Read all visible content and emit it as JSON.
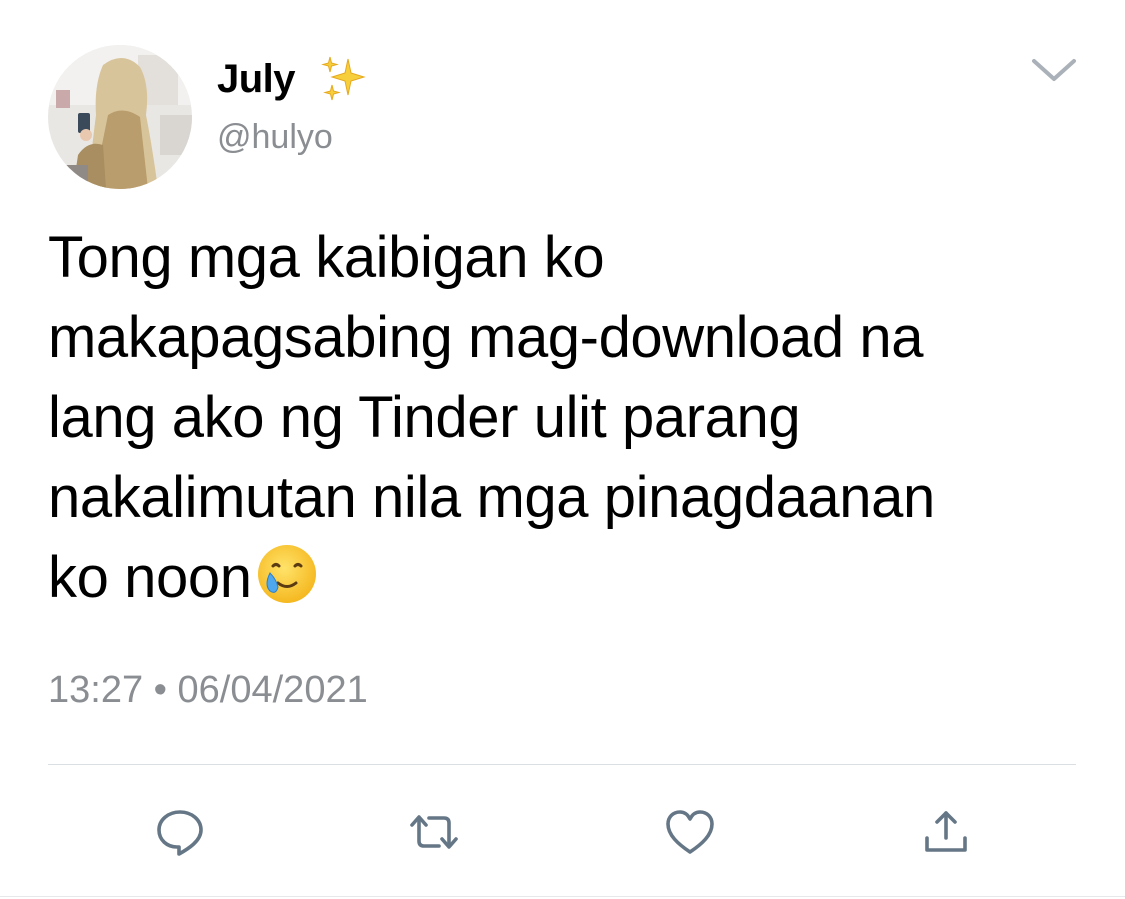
{
  "tweet": {
    "author": {
      "display_name": "July",
      "handle": "@hulyo",
      "avatar_icon": "profile-photo",
      "badge_icon": "sparkles-emoji"
    },
    "text_lines": "Tong mga kaibigan ko\nmakapagsabing mag-download na\nlang ako ng Tinder ulit parang\nnakalimutan nila mga pinagdaanan\nko noon",
    "trailing_emoji": "smiling-face-with-tear-emoji",
    "time": "13:27",
    "separator": "•",
    "date": "06/04/2021"
  },
  "actions": [
    {
      "name": "reply",
      "icon": "reply-icon"
    },
    {
      "name": "retweet",
      "icon": "retweet-icon"
    },
    {
      "name": "like",
      "icon": "heart-icon"
    },
    {
      "name": "share",
      "icon": "share-icon"
    }
  ],
  "colors": {
    "text": "#000000",
    "secondary_text": "#8a8d91",
    "icon": "#657786",
    "divider": "#dcdfe2"
  }
}
